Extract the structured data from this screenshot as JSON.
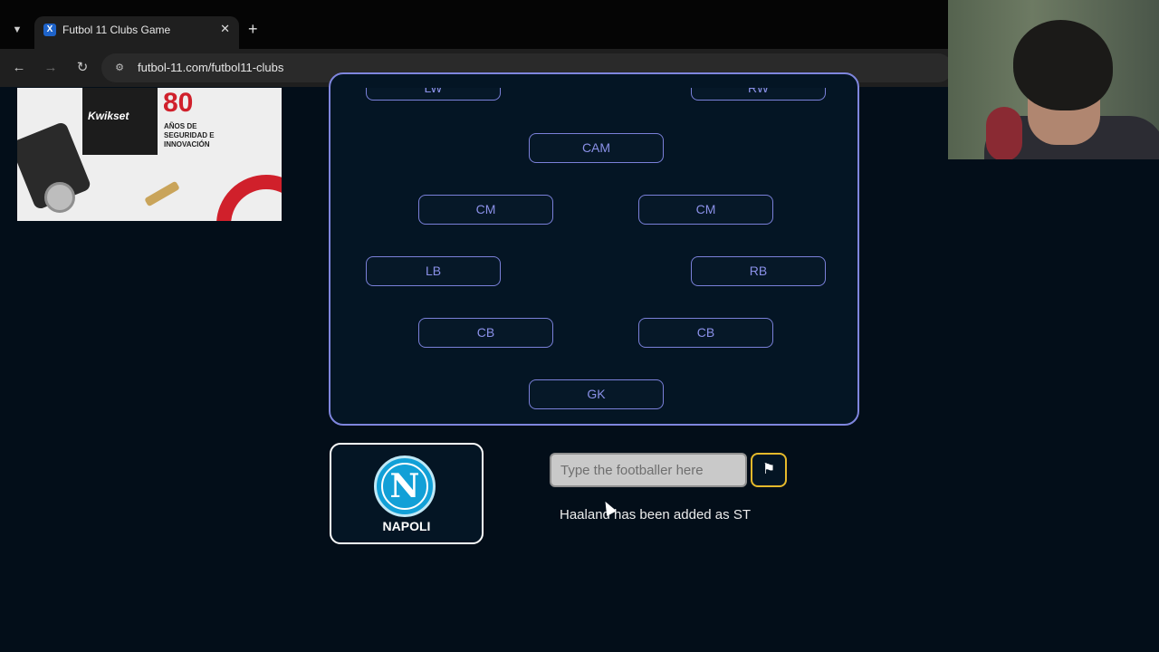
{
  "browser": {
    "tab_list_icon": "chevron-down-icon",
    "tab": {
      "title": "Futbol 11 Clubs Game",
      "favicon": "futbol11-favicon",
      "close": "✕"
    },
    "new_tab": "+",
    "back": "←",
    "forward": "→",
    "reload": "↻",
    "url": "futbol-11.com/futbol11-clubs"
  },
  "ad": {
    "brand": "Kwikset",
    "years": "80",
    "tagline": "AÑOS DE SEGURIDAD E INNOVACIÓN"
  },
  "pitch": {
    "positions": {
      "lw": "LW",
      "rw": "RW",
      "cam": "CAM",
      "cm_left": "CM",
      "cm_right": "CM",
      "lb": "LB",
      "rb": "RB",
      "cb_left": "CB",
      "cb_right": "CB",
      "gk": "GK"
    }
  },
  "club": {
    "name": "NAPOLI",
    "logo_letter": "N"
  },
  "guess": {
    "placeholder": "Type the footballer here",
    "value": "",
    "flag_icon": "⚑"
  },
  "status": {
    "message": "Haaland has been added as ST"
  },
  "colors": {
    "background": "#030e19",
    "accent": "#7f86de",
    "flag_border": "#e5b92b",
    "club_blue": "#12a0d7"
  }
}
